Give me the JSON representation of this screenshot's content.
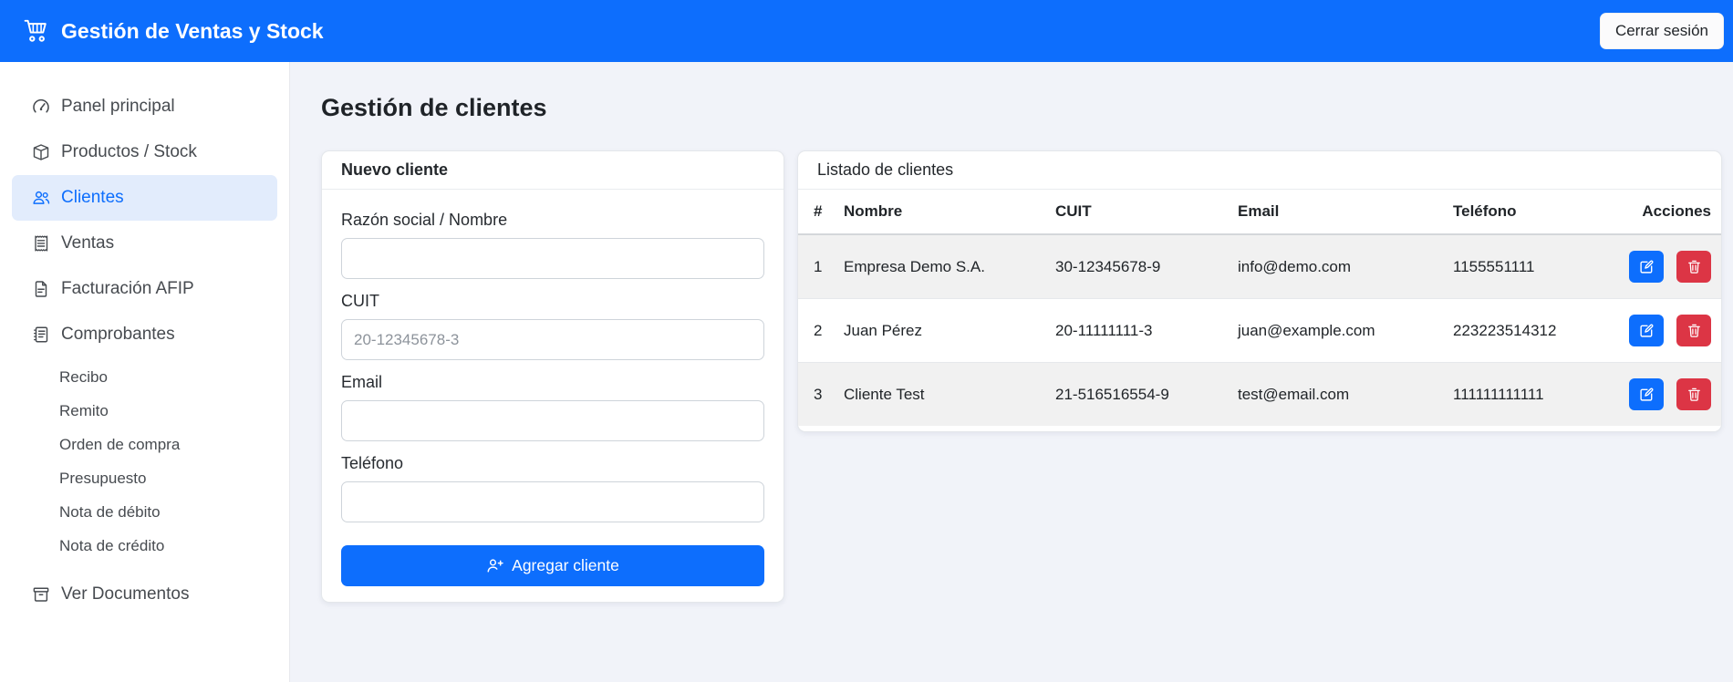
{
  "header": {
    "title": "Gestión de Ventas y Stock",
    "icon": "cart-icon",
    "logout_label": "Cerrar sesión"
  },
  "sidebar": {
    "items": [
      {
        "label": "Panel principal",
        "icon": "speedometer-icon",
        "active": false
      },
      {
        "label": "Productos / Stock",
        "icon": "box-icon",
        "active": false
      },
      {
        "label": "Clientes",
        "icon": "people-icon",
        "active": true
      },
      {
        "label": "Ventas",
        "icon": "receipt-icon",
        "active": false
      },
      {
        "label": "Facturación AFIP",
        "icon": "file-text-icon",
        "active": false
      },
      {
        "label": "Comprobantes",
        "icon": "journal-icon",
        "active": false
      }
    ],
    "subitems": [
      {
        "label": "Recibo"
      },
      {
        "label": "Remito"
      },
      {
        "label": "Orden de compra"
      },
      {
        "label": "Presupuesto"
      },
      {
        "label": "Nota de débito"
      },
      {
        "label": "Nota de crédito"
      }
    ],
    "documents_item": {
      "label": "Ver Documentos",
      "icon": "archive-icon"
    }
  },
  "main": {
    "page_title": "Gestión de clientes",
    "new_client": {
      "title": "Nuevo cliente",
      "fields": [
        {
          "label": "Razón social / Nombre",
          "value": "",
          "placeholder": ""
        },
        {
          "label": "CUIT",
          "value": "",
          "placeholder": "20-12345678-3"
        },
        {
          "label": "Email",
          "value": "",
          "placeholder": ""
        },
        {
          "label": "Teléfono",
          "value": "",
          "placeholder": ""
        }
      ],
      "submit_label": "Agregar cliente",
      "submit_icon": "person-plus-icon"
    },
    "clients_list": {
      "title": "Listado de clientes",
      "columns": [
        "#",
        "Nombre",
        "CUIT",
        "Email",
        "Teléfono",
        "Acciones"
      ],
      "rows": [
        {
          "num": "1",
          "nombre": "Empresa Demo S.A.",
          "cuit": "30-12345678-9",
          "email": "info@demo.com",
          "telefono": "1155551111"
        },
        {
          "num": "2",
          "nombre": "Juan Pérez",
          "cuit": "20-11111111-3",
          "email": "juan@example.com",
          "telefono": "223223514312"
        },
        {
          "num": "3",
          "nombre": "Cliente Test",
          "cuit": "21-516516554-9",
          "email": "test@email.com",
          "telefono": "111111111111"
        }
      ],
      "row_actions": [
        "edit",
        "delete"
      ]
    }
  },
  "colors": {
    "primary": "#0d6efd",
    "danger": "#dc3545",
    "header_bg": "#0d6efd",
    "active_nav_bg": "#e2ecfc",
    "active_nav_text": "#0d6efd",
    "main_bg": "#f1f3f9",
    "stripe_bg": "#f1f1f1"
  }
}
